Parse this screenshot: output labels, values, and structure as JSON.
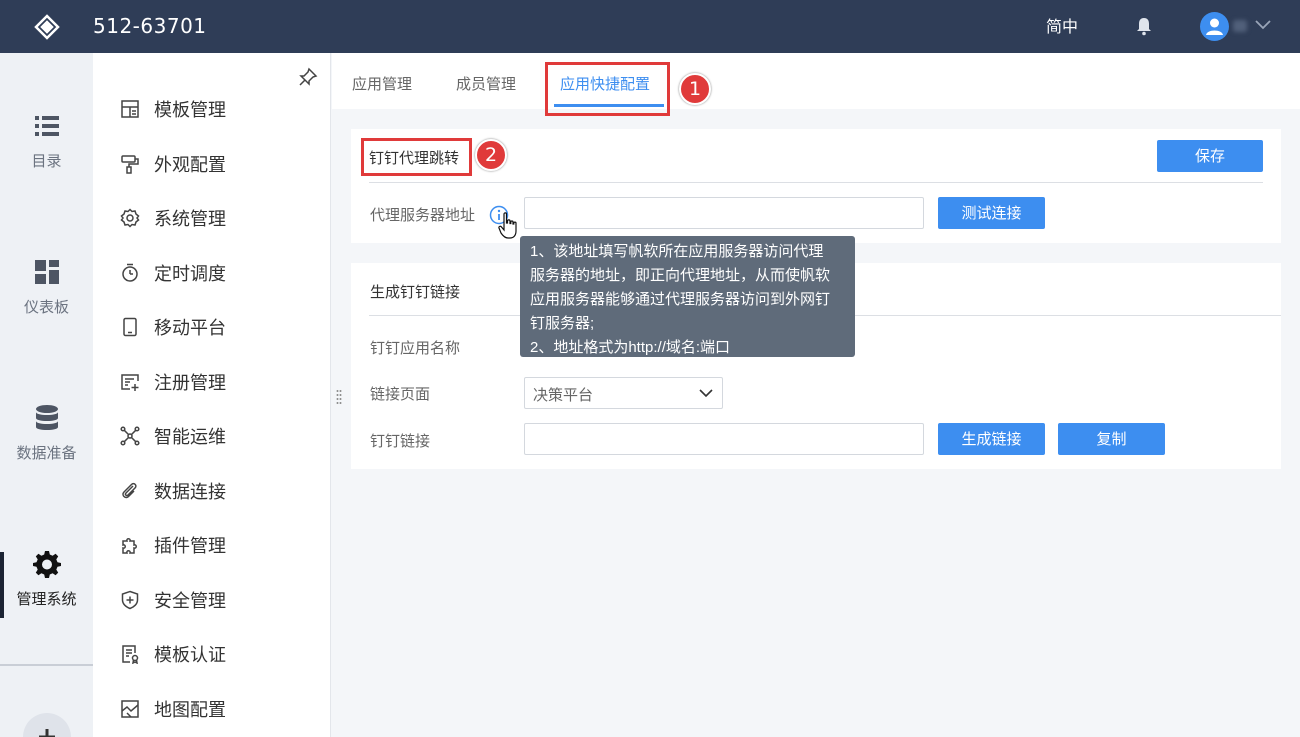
{
  "header": {
    "title": "512-63701",
    "language": "简中"
  },
  "rail": {
    "items": [
      {
        "label": "目录",
        "icon": "list-icon"
      },
      {
        "label": "仪表板",
        "icon": "dashboard-icon"
      },
      {
        "label": "数据准备",
        "icon": "database-icon"
      },
      {
        "label": "管理系统",
        "icon": "gear-icon"
      }
    ]
  },
  "sidebar": {
    "items": [
      {
        "label": "模板管理",
        "icon": "template-icon"
      },
      {
        "label": "外观配置",
        "icon": "paint-roller-icon"
      },
      {
        "label": "系统管理",
        "icon": "settings-icon"
      },
      {
        "label": "定时调度",
        "icon": "timer-icon"
      },
      {
        "label": "移动平台",
        "icon": "mobile-icon"
      },
      {
        "label": "注册管理",
        "icon": "register-icon"
      },
      {
        "label": "智能运维",
        "icon": "network-icon"
      },
      {
        "label": "数据连接",
        "icon": "paperclip-icon"
      },
      {
        "label": "插件管理",
        "icon": "puzzle-icon"
      },
      {
        "label": "安全管理",
        "icon": "shield-icon"
      },
      {
        "label": "模板认证",
        "icon": "certificate-icon"
      },
      {
        "label": "地图配置",
        "icon": "map-icon"
      }
    ]
  },
  "tabs": [
    {
      "label": "应用管理",
      "active": false
    },
    {
      "label": "成员管理",
      "active": false
    },
    {
      "label": "应用快捷配置",
      "active": true
    }
  ],
  "annotations": {
    "badge1": "1",
    "badge2": "2"
  },
  "proxy_section": {
    "title": "钉钉代理跳转",
    "save_label": "保存",
    "server_label": "代理服务器地址",
    "server_value": "",
    "test_label": "测试连接"
  },
  "tooltip": {
    "lines": [
      "1、该地址填写帆软所在应用服务器访问代理",
      "服务器的地址，即正向代理地址，从而使帆软",
      "应用服务器能够通过代理服务器访问到外网钉",
      "钉服务器;",
      "2、地址格式为http://域名:端口"
    ]
  },
  "link_section": {
    "title": "生成钉钉链接",
    "app_name_label": "钉钉应用名称",
    "page_label": "链接页面",
    "page_value": "决策平台",
    "link_label": "钉钉链接",
    "link_value": "",
    "generate_label": "生成链接",
    "copy_label": "复制"
  },
  "colors": {
    "accent": "#3d8ef0",
    "header": "#2f3d57",
    "highlight": "#e03a3a"
  }
}
